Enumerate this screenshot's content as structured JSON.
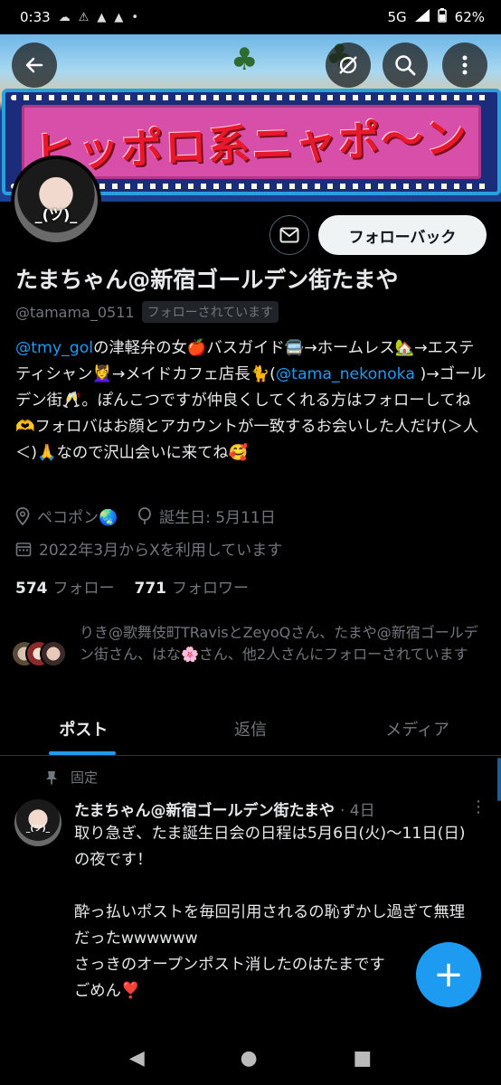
{
  "statusbar": {
    "time": "0:33",
    "left_icons": [
      "☁",
      "⚠",
      "▲",
      "▲",
      "•"
    ],
    "network": "5G",
    "battery": "62%"
  },
  "banner": {
    "sign_text": "ヒッポロ系ニャポ〜ン"
  },
  "header_buttons": {
    "back_icon": "←",
    "hide_icon": "⊘",
    "search_icon": "⌕",
    "more_icon": "⋮"
  },
  "profile": {
    "avatar_text": "_(ツ)_",
    "mail_icon": "✉",
    "follow_back_label": "フォローバック",
    "display_name": "たまちゃん@新宿ゴールデン街たまや",
    "handle": "@tamama_0511",
    "follows_you": "フォローされています",
    "bio": {
      "mention1": "@tmy_gol",
      "part1": "の津軽弁の女🍎バスガイド🚍→ホームレス🏡→エステティシャン💆‍♀️→メイドカフェ店長🐈(",
      "mention2": "@tama_nekonoka",
      "part2": " )→ゴールデン街🥂。ぽんこつですが仲良くしてくれる方はフォローしてね🫶フォロバはお顔とアカウントが一致するお会いした人だけ(＞人＜)🙏なので沢山会いに来てね🥰"
    },
    "location": "ペコポン🌏",
    "birthday": "誕生日: 5月11日",
    "joined": "2022年3月からXを利用しています",
    "following_count": "574",
    "following_label": "フォロー",
    "followers_count": "771",
    "followers_label": "フォロワー",
    "followed_by": "りき@歌舞伎町TRavisとZeyoQさん、たまや@新宿ゴールデン街さん、はな🌸さん、他2人さんにフォローされています"
  },
  "tabs": [
    {
      "label": "ポスト"
    },
    {
      "label": "返信"
    },
    {
      "label": "メディア"
    }
  ],
  "post": {
    "pinned_label": "固定",
    "author": "たまちゃん@新宿ゴールデン街たまや",
    "time": "· 4日",
    "more_icon": "⋮",
    "body": "取り急ぎ、たま誕生日会の日程は5月6日(火)〜11日(日)の夜です！\n\n酔っ払いポストを毎回引用されるの恥ずかし過ぎて無理だったwwwwww\nさっきのオープンポスト消したのはたまです\nごめん❣️"
  },
  "fab_icon": "+",
  "navbar": {
    "back": "◀",
    "home": "●",
    "recents": "■"
  }
}
